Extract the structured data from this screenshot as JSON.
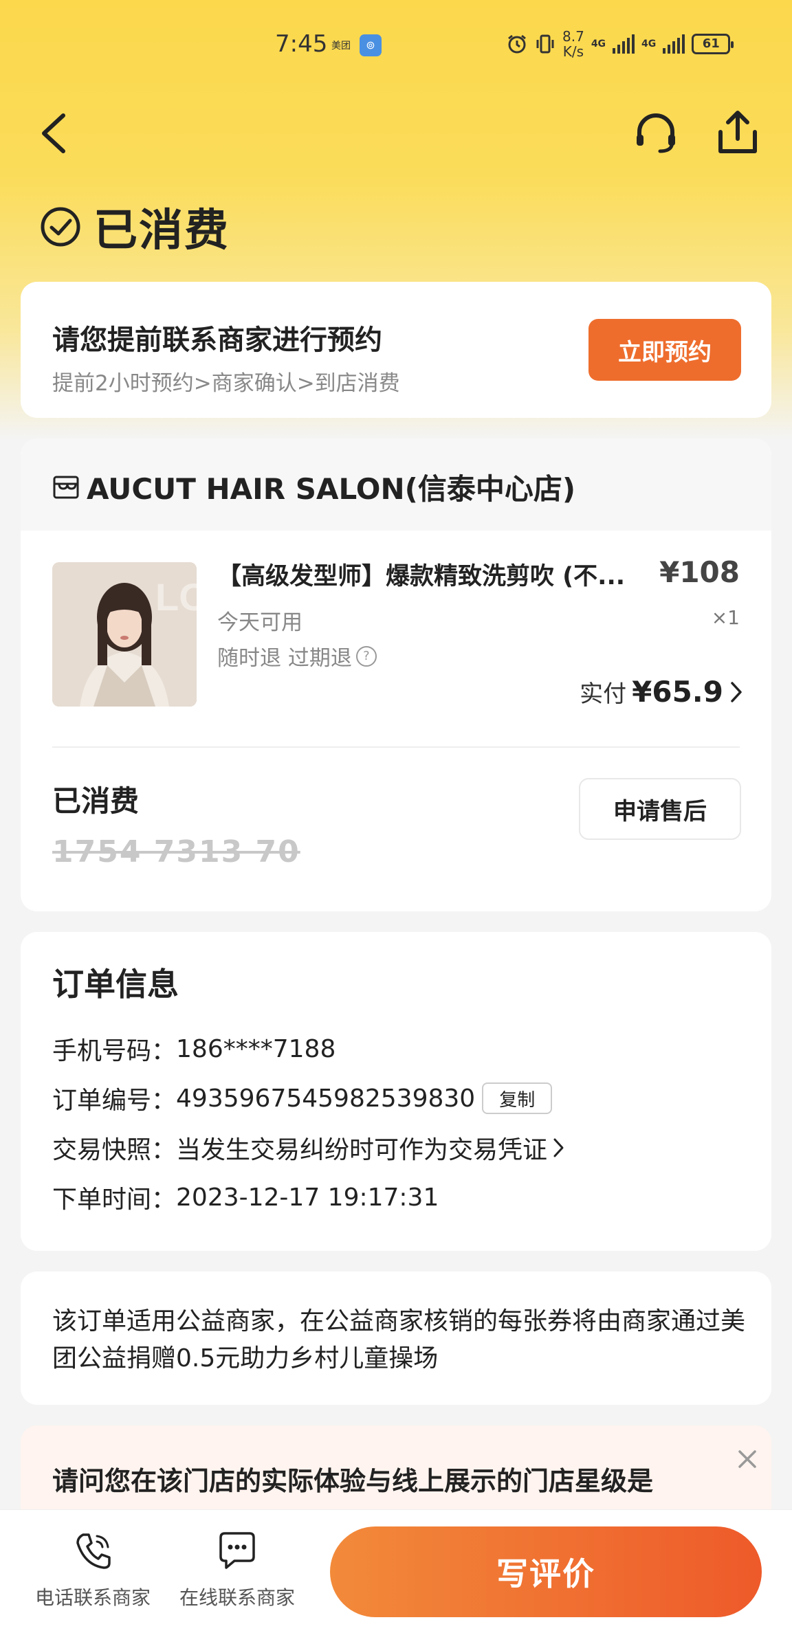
{
  "status_bar": {
    "time": "7:45",
    "meituan_tag": "美团",
    "app_badge": "⊚",
    "net_speed_value": "8.7",
    "net_speed_unit": "K/s",
    "net_type_1": "4G",
    "net_type_2": "4G",
    "battery": "61"
  },
  "header": {
    "status_title": "已消费"
  },
  "booking": {
    "title": "请您提前联系商家进行预约",
    "subtitle": "提前2小时预约>商家确认>到店消费",
    "button": "立即预约"
  },
  "order": {
    "shop_name": "AUCUT HAIR SALON(信泰中心店)",
    "product_title": "【高级发型师】爆款精致洗剪吹 (不...",
    "price": "¥108",
    "availability": "今天可用",
    "quantity": "×1",
    "refund_policy": "随时退 过期退",
    "paid_label": "实付",
    "paid_amount": "¥65.9",
    "consumed_label": "已消费",
    "voucher_code": "1754 7313 70",
    "after_sale_button": "申请售后"
  },
  "order_info": {
    "title": "订单信息",
    "phone_label": "手机号码：",
    "phone": "186****7188",
    "order_no_label": "订单编号：",
    "order_no": "4935967545982539830",
    "copy_button": "复制",
    "snapshot_label": "交易快照：",
    "snapshot_text": "当发生交易纠纷时可作为交易凭证",
    "time_label": "下单时间：",
    "order_time": "2023-12-17 19:17:31"
  },
  "charity": {
    "text": "该订单适用公益商家，在公益商家核销的每张券将由商家通过美团公益捐赠0.5元助力乡村儿童操场"
  },
  "survey": {
    "question": "请问您在该门店的实际体验与线上展示的门店星级是"
  },
  "bottom_bar": {
    "phone_contact": "电话联系商家",
    "online_contact": "在线联系商家",
    "review_button": "写评价"
  },
  "colors": {
    "accent": "#ee6d2d",
    "header_yellow": "#fbd84c"
  }
}
